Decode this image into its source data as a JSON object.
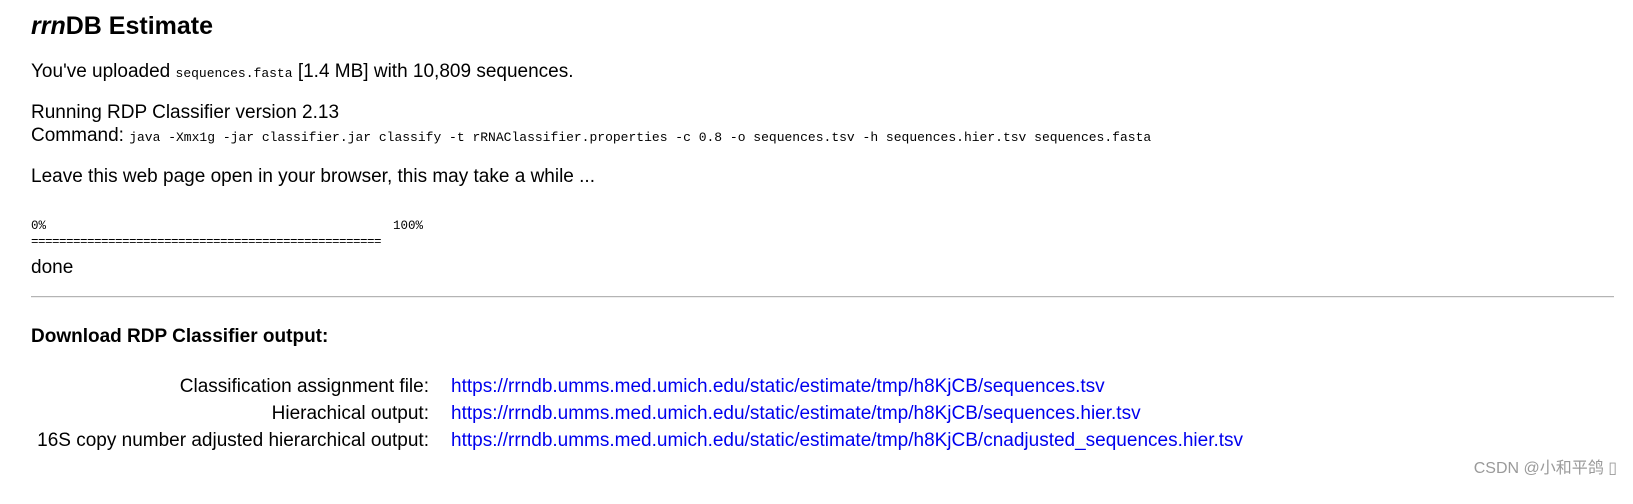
{
  "heading": {
    "italic": "rrn",
    "rest": "DB Estimate"
  },
  "upload": {
    "prefix": "You've uploaded ",
    "filename": "sequences.fasta",
    "suffix": " [1.4 MB] with 10,809 sequences."
  },
  "classifier": {
    "running": "Running RDP Classifier version 2.13",
    "command_label": "Command: ",
    "command": "java -Xmx1g -jar classifier.jar classify -t rRNAClassifier.properties -c 0.8 -o sequences.tsv -h sequences.hier.tsv sequences.fasta"
  },
  "notice": "Leave this web page open in your browser, this may take a while ...",
  "progress": {
    "start_label": "0%",
    "end_label": "100%",
    "value_percent": 100,
    "bar_text": "=================================================="
  },
  "status": "done",
  "download": {
    "heading": "Download RDP Classifier output:",
    "files": [
      {
        "label": "Classification assignment file:",
        "url": "https://rrndb.umms.med.umich.edu/static/estimate/tmp/h8KjCB/sequences.tsv"
      },
      {
        "label": "Hierachical output:",
        "url": "https://rrndb.umms.med.umich.edu/static/estimate/tmp/h8KjCB/sequences.hier.tsv"
      },
      {
        "label": "16S copy number adjusted hierarchical output:",
        "url": "https://rrndb.umms.med.umich.edu/static/estimate/tmp/h8KjCB/cnadjusted_sequences.hier.tsv"
      }
    ]
  },
  "watermark": "CSDN @小和平鸽 ▯",
  "colors": {
    "link": "#0000ee",
    "separator": "#b4b4b4",
    "watermark": "#9a9a9a"
  }
}
